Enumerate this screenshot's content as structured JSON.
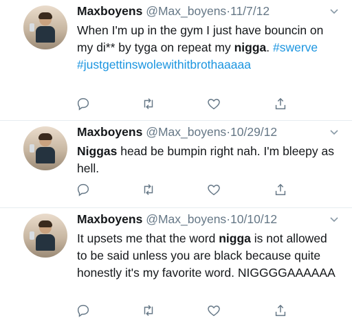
{
  "tweets": [
    {
      "name": "Maxboyens",
      "handle": "@Max_boyens",
      "separator": "·",
      "date": "11/7/12",
      "text_parts": [
        {
          "t": "When I'm up in the gym I just have bouncin on my di** by tyga on repeat my ",
          "style": "plain"
        },
        {
          "t": "nigga",
          "style": "bold"
        },
        {
          "t": ". ",
          "style": "plain"
        },
        {
          "t": "#swerve",
          "style": "link"
        },
        {
          "t": " ",
          "style": "plain"
        },
        {
          "t": "#justgettinswolewithitbrothaaaaa",
          "style": "link"
        }
      ]
    },
    {
      "name": "Maxboyens",
      "handle": "@Max_boyens",
      "separator": "·",
      "date": "10/29/12",
      "text_parts": [
        {
          "t": "Niggas",
          "style": "bold"
        },
        {
          "t": " head be bumpin right nah. I'm bleepy as hell.",
          "style": "plain"
        }
      ]
    },
    {
      "name": "Maxboyens",
      "handle": "@Max_boyens",
      "separator": "·",
      "date": "10/10/12",
      "text_parts": [
        {
          "t": "It upsets me that the word ",
          "style": "plain"
        },
        {
          "t": "nigga",
          "style": "bold"
        },
        {
          "t": " is not allowed to be said unless you are black because quite honestly it's my favorite word. NIGGGGAAAAAA",
          "style": "plain"
        }
      ]
    }
  ],
  "icons": {
    "menu": "chevron-down-icon",
    "reply": "reply-icon",
    "retweet": "retweet-icon",
    "like": "heart-icon",
    "share": "share-icon"
  },
  "colors": {
    "name": "#14171a",
    "muted": "#657786",
    "link": "#1b95e0",
    "icon": "#657786",
    "divider": "#e6ecf0"
  }
}
